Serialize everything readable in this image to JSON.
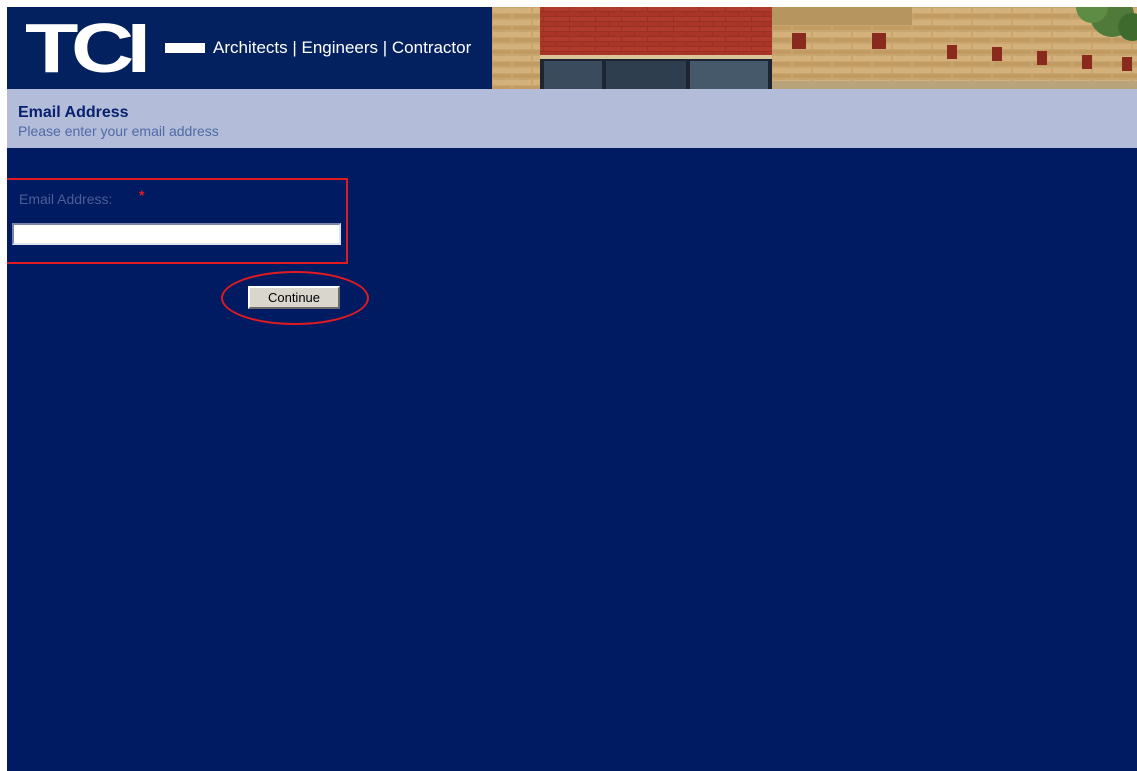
{
  "banner": {
    "logo_text": "TCI",
    "tagline": "Architects | Engineers | Contractor"
  },
  "header": {
    "title": "Email Address",
    "subtitle": "Please enter your email address"
  },
  "form": {
    "email_label": "Email Address:",
    "required_mark": "*",
    "email_value": "",
    "continue_label": "Continue"
  },
  "colors": {
    "page_background": "#001b62",
    "title_strip": "#b3bcd8",
    "title_text": "#08216e",
    "annotation_red": "#e01b20"
  }
}
